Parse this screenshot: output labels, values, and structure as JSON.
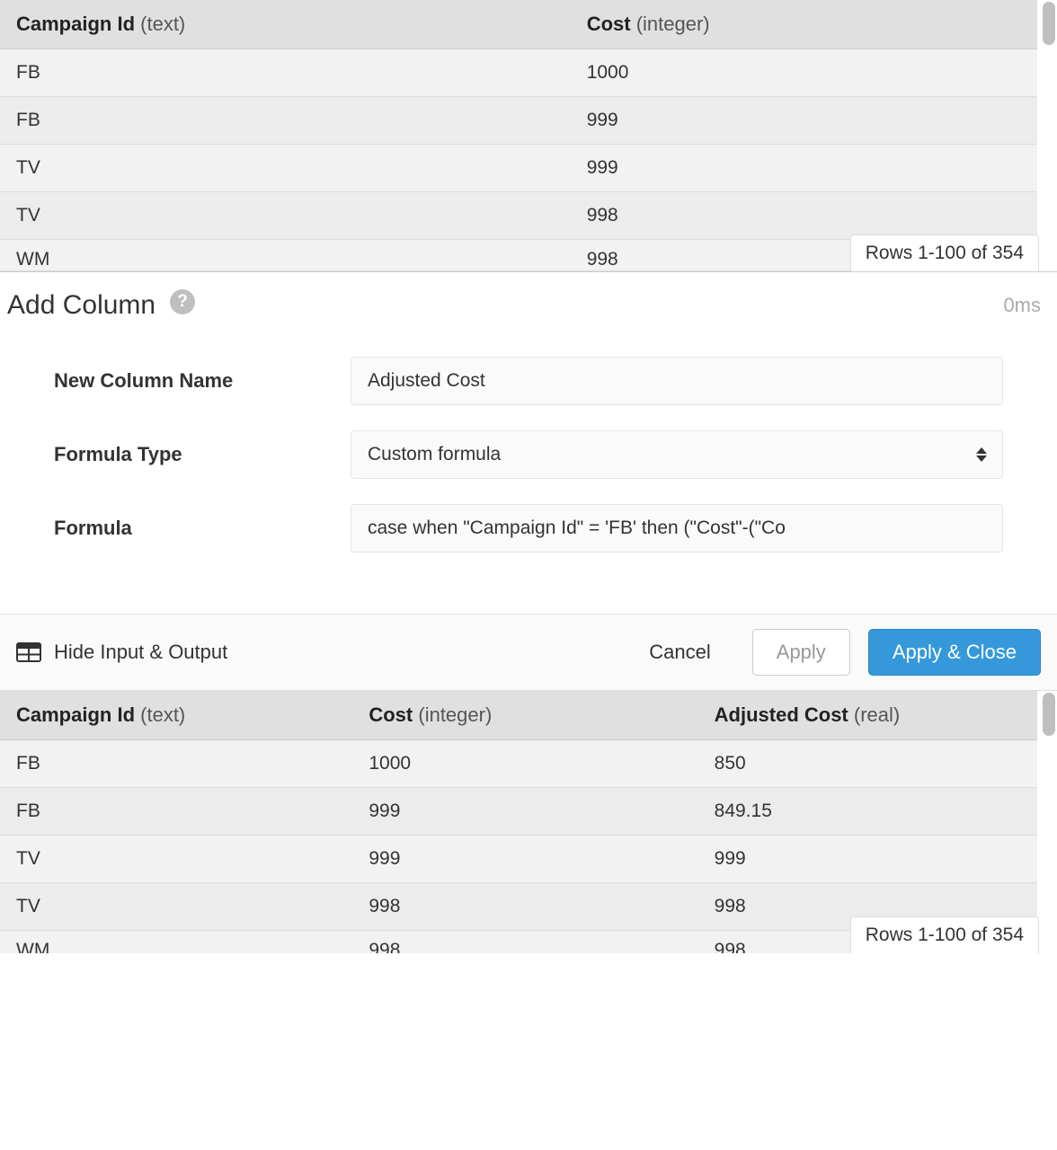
{
  "top_table": {
    "columns": [
      {
        "name": "Campaign Id",
        "type": "(text)"
      },
      {
        "name": "Cost",
        "type": "(integer)"
      }
    ],
    "rows": [
      {
        "campaign_id": "FB",
        "cost": "1000"
      },
      {
        "campaign_id": "FB",
        "cost": "999"
      },
      {
        "campaign_id": "TV",
        "cost": "999"
      },
      {
        "campaign_id": "TV",
        "cost": "998"
      }
    ],
    "partial_row": {
      "campaign_id": "WM",
      "cost": "998"
    },
    "rows_badge": "Rows 1-100 of 354"
  },
  "panel": {
    "title": "Add Column",
    "timing": "0ms",
    "labels": {
      "new_col_name": "New Column Name",
      "formula_type": "Formula Type",
      "formula": "Formula"
    },
    "values": {
      "new_col_name": "Adjusted Cost",
      "formula_type": "Custom formula",
      "formula": "case when \"Campaign Id\" = 'FB' then (\"Cost\"-(\"Co"
    },
    "footer": {
      "toggle_label": "Hide Input & Output",
      "cancel": "Cancel",
      "apply": "Apply",
      "apply_close": "Apply & Close"
    }
  },
  "bottom_table": {
    "columns": [
      {
        "name": "Campaign Id",
        "type": "(text)"
      },
      {
        "name": "Cost",
        "type": "(integer)"
      },
      {
        "name": "Adjusted Cost",
        "type": "(real)"
      }
    ],
    "rows": [
      {
        "campaign_id": "FB",
        "cost": "1000",
        "adjusted": "850"
      },
      {
        "campaign_id": "FB",
        "cost": "999",
        "adjusted": "849.15"
      },
      {
        "campaign_id": "TV",
        "cost": "999",
        "adjusted": "999"
      },
      {
        "campaign_id": "TV",
        "cost": "998",
        "adjusted": "998"
      }
    ],
    "partial_row": {
      "campaign_id": "WM",
      "cost": "998",
      "adjusted": "998"
    },
    "rows_badge": "Rows 1-100 of 354"
  }
}
